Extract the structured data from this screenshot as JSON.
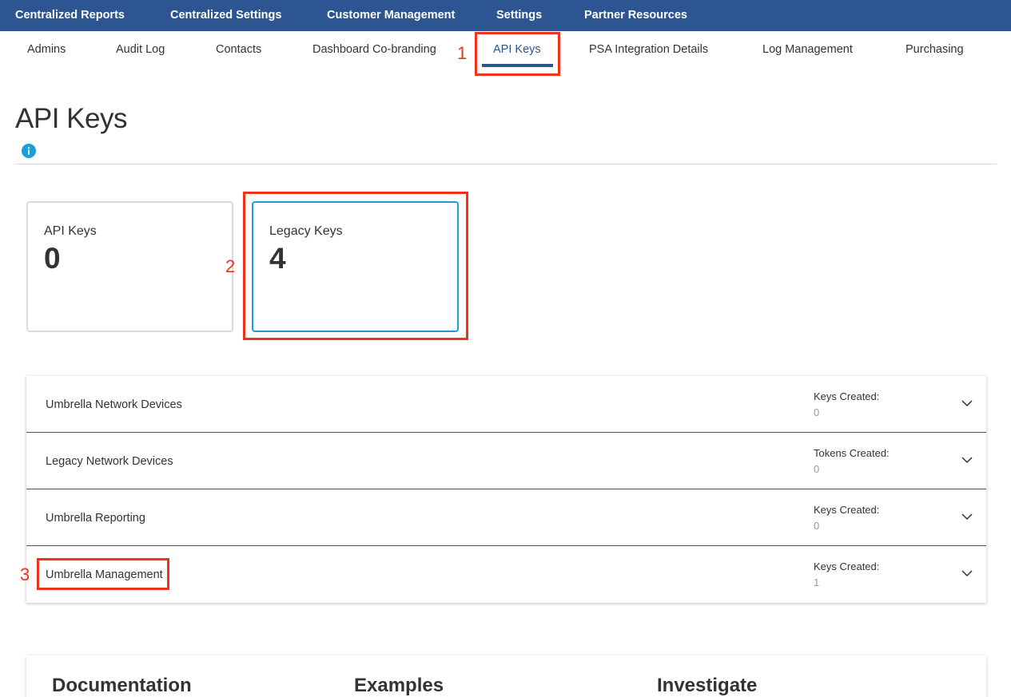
{
  "topnav": {
    "items": [
      "Centralized Reports",
      "Centralized Settings",
      "Customer Management",
      "Settings",
      "Partner Resources"
    ]
  },
  "subnav": {
    "items": [
      "Admins",
      "Audit Log",
      "Contacts",
      "Dashboard Co-branding",
      "API Keys",
      "PSA Integration Details",
      "Log Management",
      "Purchasing"
    ],
    "active": "API Keys"
  },
  "annotations": [
    "1",
    "2",
    "3"
  ],
  "page": {
    "title": "API Keys",
    "info_icon": "info-icon"
  },
  "cards": [
    {
      "label": "API Keys",
      "count": "0"
    },
    {
      "label": "Legacy Keys",
      "count": "4"
    }
  ],
  "key_groups": [
    {
      "name": "Umbrella Network Devices",
      "meta_label": "Keys Created:",
      "meta_value": "0"
    },
    {
      "name": "Legacy Network Devices",
      "meta_label": "Tokens Created:",
      "meta_value": "0"
    },
    {
      "name": "Umbrella Reporting",
      "meta_label": "Keys Created:",
      "meta_value": "0"
    },
    {
      "name": "Umbrella Management",
      "meta_label": "Keys Created:",
      "meta_value": "1"
    }
  ],
  "resources": {
    "columns": [
      "Documentation",
      "Examples",
      "Investigate"
    ]
  },
  "colors": {
    "nav_bg": "#2d5591",
    "accent": "#1a9fd9",
    "annotation": "#f2321b"
  }
}
